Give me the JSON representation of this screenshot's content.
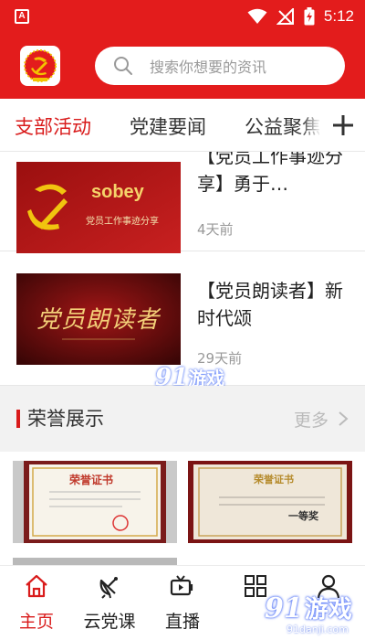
{
  "status_bar": {
    "time": "5:12",
    "app_badge": "A"
  },
  "header": {
    "search_placeholder": "搜索你想要的资讯"
  },
  "tabs": [
    {
      "label": "支部活动",
      "active": true
    },
    {
      "label": "党建要闻",
      "active": false
    },
    {
      "label": "公益聚焦",
      "active": false
    }
  ],
  "news": [
    {
      "title": "【党员工作事迹分享】勇于…",
      "time": "4天前",
      "thumb_brand": "sobey",
      "thumb_caption": "党员工作事迹分享"
    },
    {
      "title": "【党员朗读者】新时代颂",
      "time": "29天前",
      "thumb_text": "党员朗读者"
    }
  ],
  "watermark": {
    "num": "91",
    "text": "游戏",
    "sub": "91danji.com"
  },
  "honor": {
    "title": "荣誉展示",
    "more": "更多"
  },
  "certificates": [
    {
      "title": "荣誉证书"
    },
    {
      "title": "荣誉证书",
      "award": "一等奖"
    }
  ],
  "bottom_nav": [
    {
      "label": "主页",
      "icon": "home-icon",
      "active": true
    },
    {
      "label": "云党课",
      "icon": "satellite-dish-icon",
      "active": false
    },
    {
      "label": "直播",
      "icon": "video-icon",
      "active": false
    },
    {
      "label": "",
      "icon": "grid-icon",
      "active": false
    },
    {
      "label": "",
      "icon": "person-icon",
      "active": false
    }
  ],
  "colors": {
    "primary": "#e31c1c",
    "accent_text": "#d91b1b",
    "muted": "#999999"
  }
}
